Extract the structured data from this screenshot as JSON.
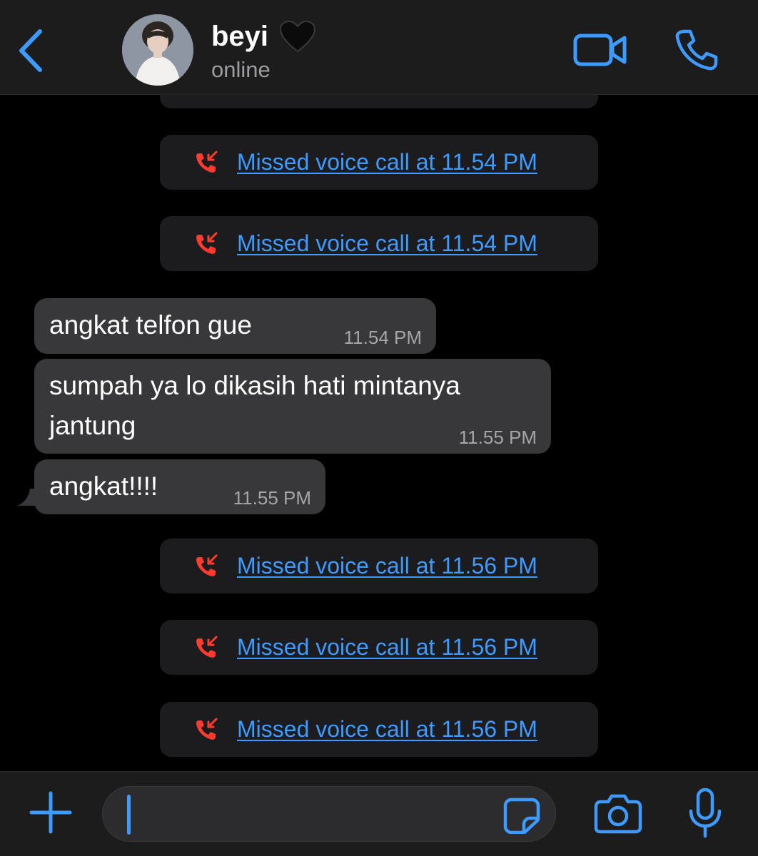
{
  "header": {
    "contact_name": "beyi",
    "status": "online",
    "icons": {
      "back": "chevron-left-icon",
      "heart": "black-heart-emoji",
      "video": "video-camera-icon",
      "call": "phone-icon"
    }
  },
  "messages": [
    {
      "type": "system",
      "partial": true,
      "text": ""
    },
    {
      "type": "system",
      "text": "Missed voice call at 11.54 PM"
    },
    {
      "type": "system",
      "text": "Missed voice call at 11.54 PM"
    },
    {
      "type": "incoming",
      "text": "angkat telfon gue",
      "time": "11.54 PM"
    },
    {
      "type": "incoming",
      "text": "sumpah ya lo dikasih hati mintanya jantung",
      "time": "11.55 PM"
    },
    {
      "type": "incoming",
      "text": "angkat!!!!",
      "time": "11.55 PM"
    },
    {
      "type": "system",
      "text": "Missed voice call at 11.56 PM"
    },
    {
      "type": "system",
      "text": "Missed voice call at 11.56 PM"
    },
    {
      "type": "system",
      "text": "Missed voice call at 11.56 PM"
    }
  ],
  "composer": {
    "value": "",
    "icons": {
      "plus": "plus-icon",
      "sticker": "sticker-icon",
      "camera": "camera-icon",
      "mic": "microphone-icon"
    }
  },
  "colors": {
    "accent": "#3d9bff",
    "missed": "#ff3b30",
    "bubble_incoming": "#38383b",
    "system_pill": "#1c1c1e",
    "background": "#000000"
  }
}
